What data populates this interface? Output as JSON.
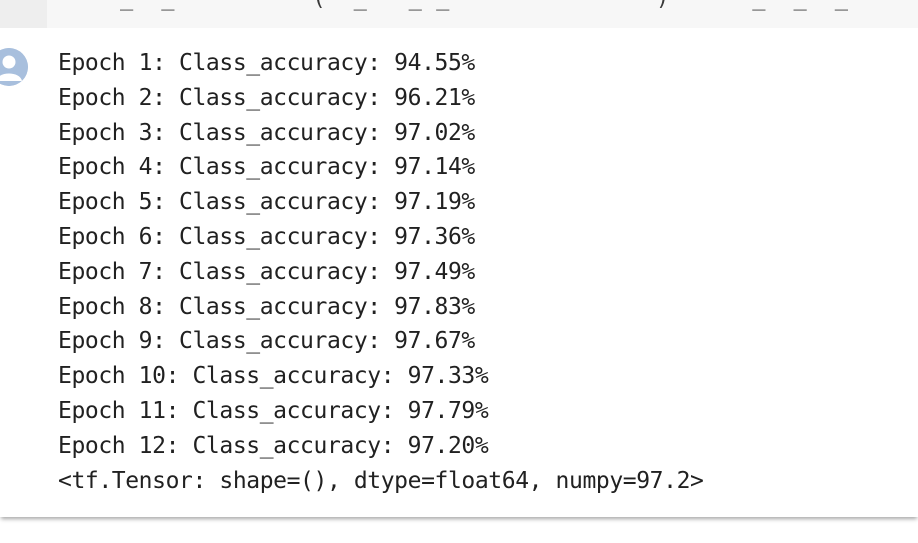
{
  "code_cell": {
    "snippet": "_  _          (  _   _ _               )      _  _  _"
  },
  "output": {
    "lines": [
      "Epoch 1: Class_accuracy: 94.55%",
      "Epoch 2: Class_accuracy: 96.21%",
      "Epoch 3: Class_accuracy: 97.02%",
      "Epoch 4: Class_accuracy: 97.14%",
      "Epoch 5: Class_accuracy: 97.19%",
      "Epoch 6: Class_accuracy: 97.36%",
      "Epoch 7: Class_accuracy: 97.49%",
      "Epoch 8: Class_accuracy: 97.83%",
      "Epoch 9: Class_accuracy: 97.67%",
      "Epoch 10: Class_accuracy: 97.33%",
      "Epoch 11: Class_accuracy: 97.79%",
      "Epoch 12: Class_accuracy: 97.20%",
      "<tf.Tensor: shape=(), dtype=float64, numpy=97.2>"
    ]
  },
  "icons": {
    "output_avatar": "user-avatar-icon"
  },
  "colors": {
    "avatar_bg": "#a8bfdd",
    "text": "#212121",
    "code_bg": "#f7f7f7"
  }
}
